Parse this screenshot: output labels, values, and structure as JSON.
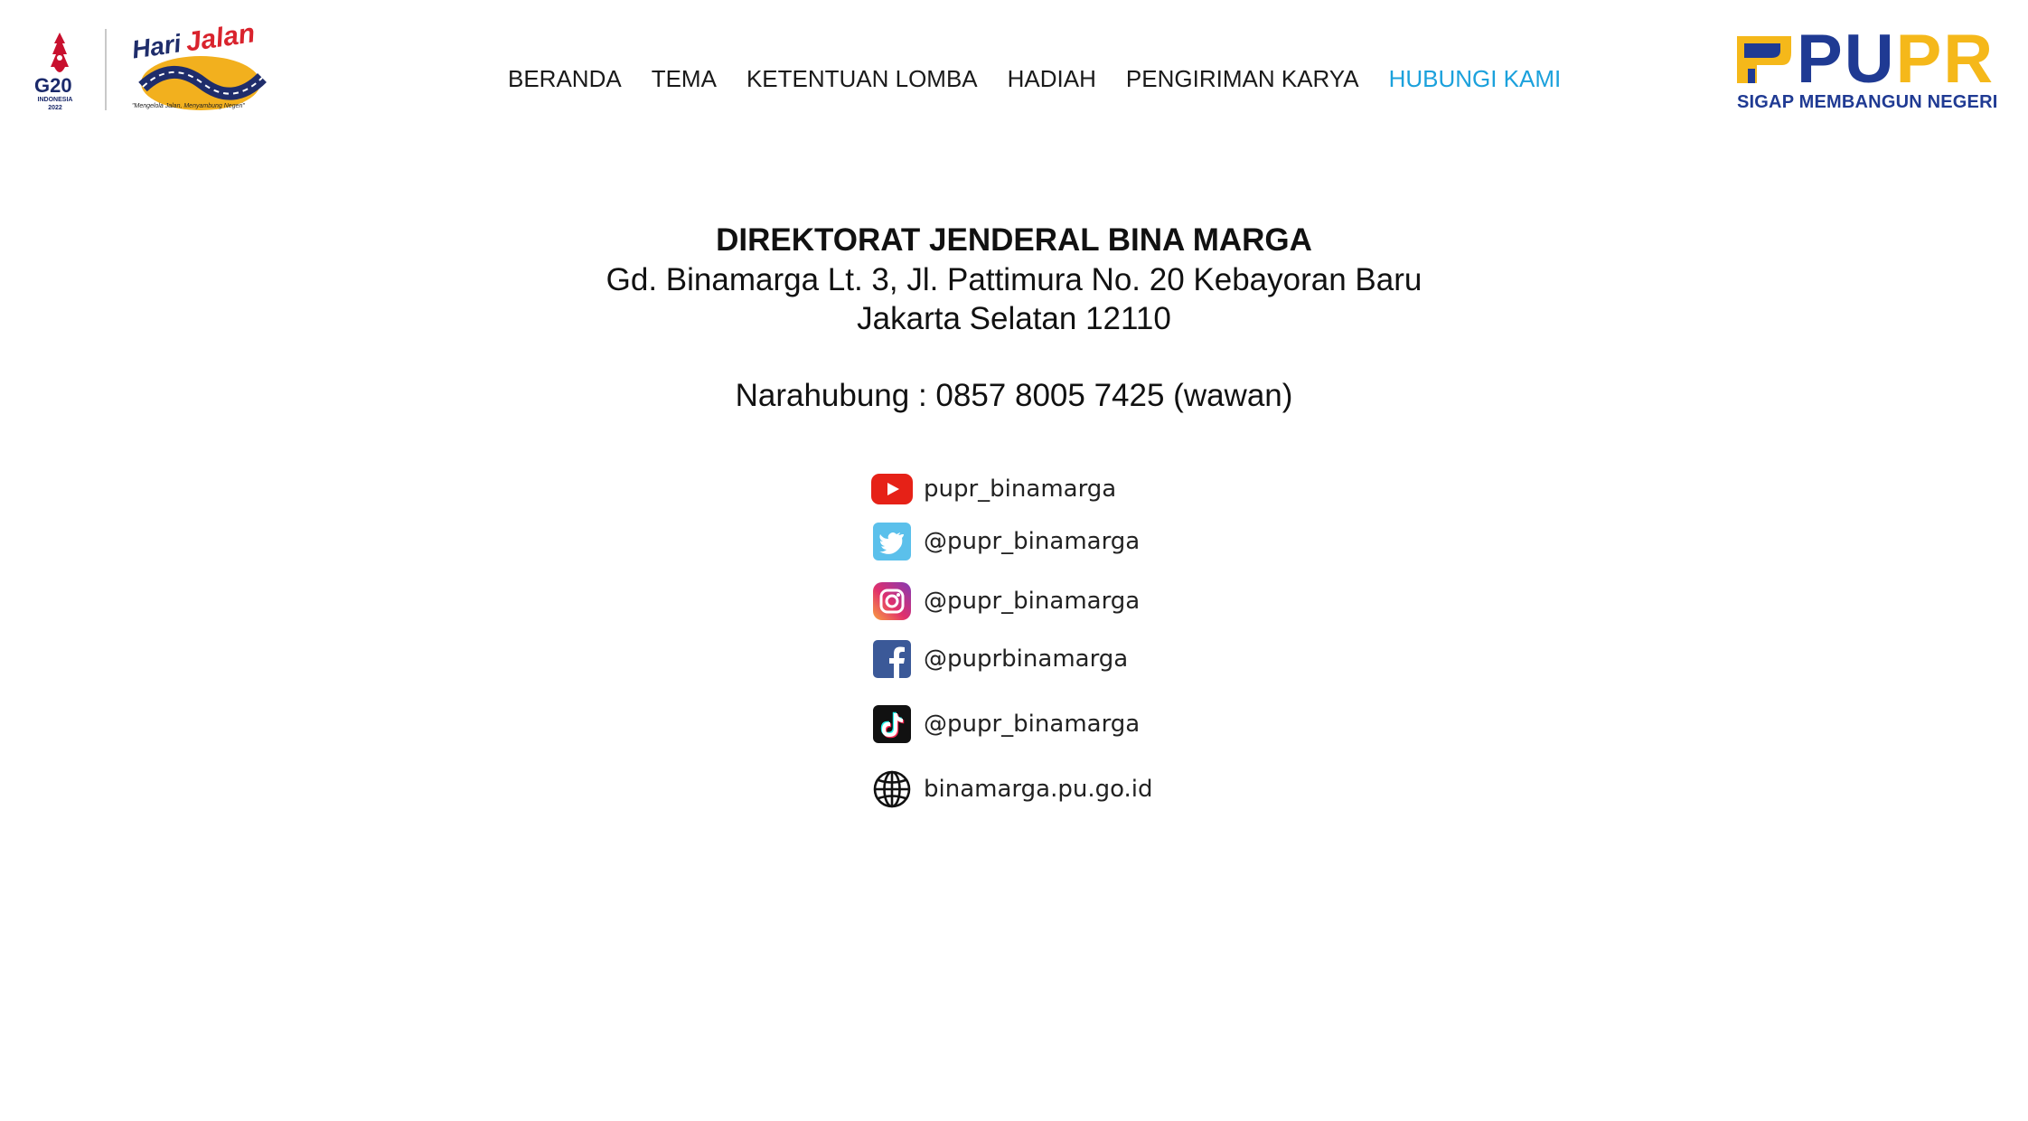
{
  "header": {
    "g20": {
      "label": "G20",
      "sublabel": "INDONESIA 2022"
    },
    "event_logo": {
      "word1": "Hari",
      "word2": "Jalan",
      "tagline": "\"Mengelola Jalan, Menyambung Negeri\""
    },
    "nav": {
      "items": [
        {
          "label": "BERANDA"
        },
        {
          "label": "TEMA"
        },
        {
          "label": "KETENTUAN LOMBA"
        },
        {
          "label": "HADIAH"
        },
        {
          "label": "PENGIRIMAN KARYA"
        },
        {
          "label": "HUBUNGI KAMI",
          "active": true
        }
      ],
      "active_color": "#1ba1dc"
    },
    "pupr": {
      "word_pu": "PU",
      "word_pr": "PR",
      "tagline": "SIGAP MEMBANGUN NEGERI",
      "color_blue": "#1f3a93",
      "color_yellow": "#f5b81a"
    }
  },
  "contact": {
    "org_name": "DIREKTORAT JENDERAL BINA MARGA",
    "address_line1": "Gd. Binamarga Lt. 3, Jl. Pattimura No. 20 Kebayoran Baru",
    "address_line2": "Jakarta Selatan 12110",
    "contact_person": "Narahubung : 0857 8005 7425 (wawan)"
  },
  "social": {
    "items": [
      {
        "icon": "youtube-icon",
        "label": "pupr_binamarga"
      },
      {
        "icon": "twitter-icon",
        "label": "@pupr_binamarga"
      },
      {
        "icon": "instagram-icon",
        "label": "@pupr_binamarga"
      },
      {
        "icon": "facebook-icon",
        "label": "@puprbinamarga"
      },
      {
        "icon": "tiktok-icon",
        "label": "@pupr_binamarga"
      },
      {
        "icon": "globe-icon",
        "label": "binamarga.pu.go.id"
      }
    ]
  }
}
